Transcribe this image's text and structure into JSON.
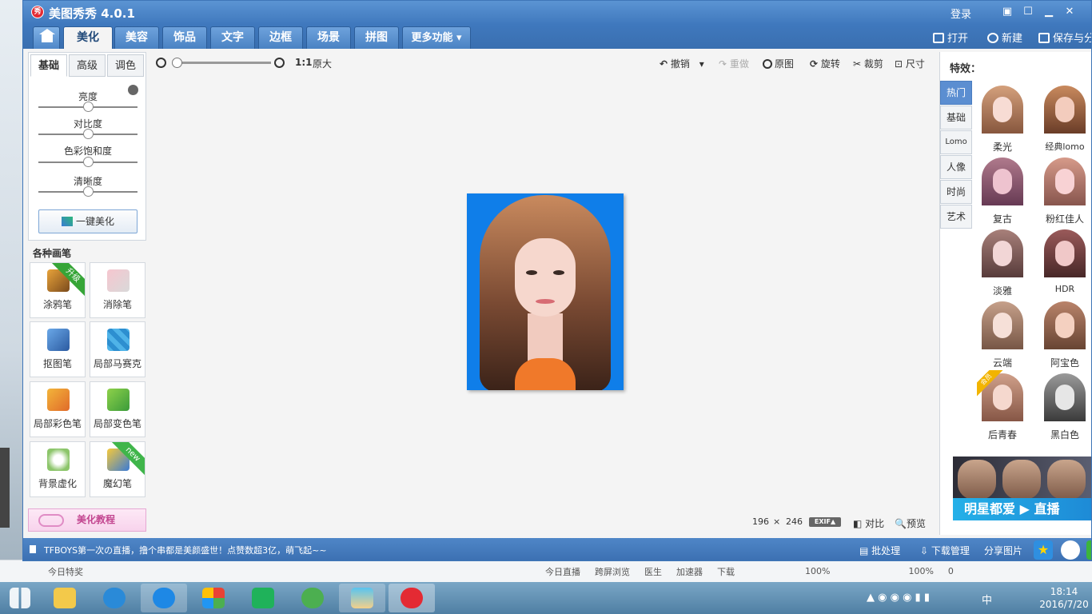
{
  "app": {
    "title": "美图秀秀 4.0.1",
    "logo_text": "秀",
    "login": "登录",
    "colors": {
      "title_bar": "#4a85c9",
      "accent": "#5b8ed1",
      "canvas_bg": "#0f7ee9"
    }
  },
  "menu": {
    "tabs": [
      {
        "label": "美化",
        "active": true
      },
      {
        "label": "美容"
      },
      {
        "label": "饰品"
      },
      {
        "label": "文字"
      },
      {
        "label": "边框"
      },
      {
        "label": "场景"
      },
      {
        "label": "拼图"
      },
      {
        "label": "更多功能 ▾"
      }
    ],
    "actions": {
      "open": "打开",
      "new": "新建",
      "save": "保存与分"
    }
  },
  "left": {
    "subtabs": [
      "基础",
      "高级",
      "调色"
    ],
    "sliders": [
      {
        "label": "亮度",
        "value": 0.5
      },
      {
        "label": "对比度",
        "value": 0.5
      },
      {
        "label": "色彩饱和度",
        "value": 0.5
      },
      {
        "label": "清晰度",
        "value": 0.5
      }
    ],
    "one_key": "一键美化",
    "brushes_title": "各种画笔",
    "tools": [
      {
        "label": "涂鸦笔",
        "badge": "升级"
      },
      {
        "label": "消除笔"
      },
      {
        "label": "抠图笔"
      },
      {
        "label": "局部马赛克"
      },
      {
        "label": "局部彩色笔"
      },
      {
        "label": "局部变色笔"
      },
      {
        "label": "背景虚化"
      },
      {
        "label": "魔幻笔",
        "badge": "new"
      }
    ],
    "tutorial": "美化教程"
  },
  "toolbar": {
    "zoom_ratio": "1:1",
    "original_size": "原大",
    "undo": "撤销",
    "redo": "重做",
    "original": "原图",
    "rotate": "旋转",
    "crop": "裁剪",
    "size": "尺寸"
  },
  "canvas": {
    "width": "196",
    "times": "×",
    "height": "246",
    "exif": "EXIF▲",
    "compare": "对比",
    "preview": "预览"
  },
  "effects": {
    "title": "特效：",
    "categories": [
      "热门",
      "基础",
      "Lomo",
      "人像",
      "时尚",
      "艺术"
    ],
    "items": [
      {
        "label": "柔光"
      },
      {
        "label": "经典lomo"
      },
      {
        "label": "复古"
      },
      {
        "label": "粉红佳人"
      },
      {
        "label": "淡雅"
      },
      {
        "label": "HDR"
      },
      {
        "label": "云端"
      },
      {
        "label": "阿宝色"
      },
      {
        "label": "后青春",
        "badge": "会员"
      },
      {
        "label": "黑白色"
      }
    ],
    "banner": "明星都爱 ▶ 直播"
  },
  "statusbar": {
    "news": "TFBOYS第一次の直播，撸个串都是美颜盛世！点赞数超3亿，萌飞起~~",
    "batch": "批处理",
    "downloads": "下载管理",
    "share": "分享图片"
  },
  "background_browser": {
    "items": [
      "今日特奖",
      "今日直播",
      "跨屏浏览",
      "医生",
      "加速器",
      "下载",
      "100%"
    ]
  },
  "taskbar": {
    "tray": {
      "ime": "中",
      "zoom": "100%",
      "count": "0"
    },
    "time": "18:14",
    "date": "2016/7/20"
  }
}
